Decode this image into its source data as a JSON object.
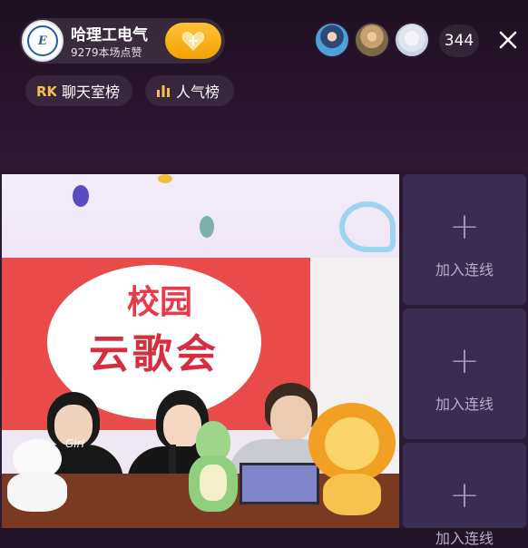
{
  "host": {
    "logo_text": "E",
    "name": "哈理工电气",
    "likes": "9279本场点赞"
  },
  "viewers": {
    "count": "344"
  },
  "rank_tabs": [
    {
      "label": "聊天室榜"
    },
    {
      "label": "人气榜"
    }
  ],
  "video": {
    "title_top": "校园",
    "title_bottom": "云歌会",
    "shirt_text": "Girl"
  },
  "side_slots": [
    {
      "label": "加入连线"
    },
    {
      "label": "加入连线"
    },
    {
      "label": "加入连线"
    }
  ],
  "colors": {
    "follow_btn": "#f5a100",
    "stage_red": "#e94a4a",
    "slot_bg": "#3a2d52"
  },
  "icons": {
    "close": "close-icon",
    "follow": "heart-plus-icon",
    "chat_rank": "chat-rank-icon",
    "popularity_rank": "bar-chart-icon",
    "add": "plus-icon"
  }
}
